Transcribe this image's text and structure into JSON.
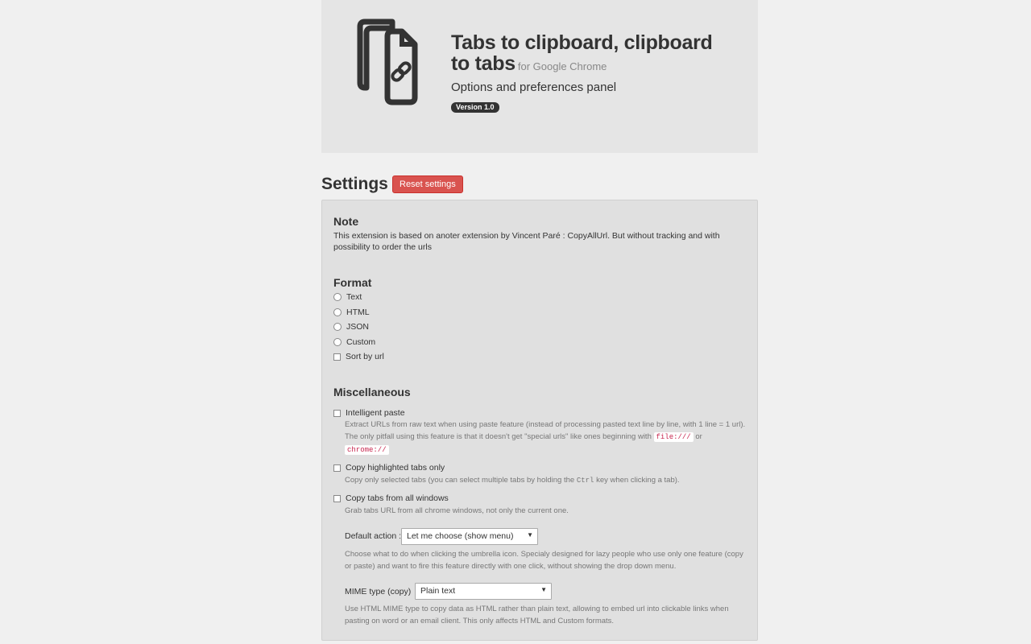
{
  "header": {
    "title": "Tabs to clipboard, clipboard to tabs",
    "title_suffix": "for Google Chrome",
    "subtitle": "Options and preferences panel",
    "version": "Version 1.0",
    "logo_icon": "documents-link-icon"
  },
  "settings": {
    "title": "Settings",
    "reset_label": "Reset settings",
    "reset_color": "#d9534f"
  },
  "note": {
    "title": "Note",
    "text": "This extension is based on anoter extension by Vincent Paré : CopyAllUrl. But without tracking and with possibility to order the urls"
  },
  "format": {
    "title": "Format",
    "options": [
      "Text",
      "HTML",
      "JSON",
      "Custom"
    ],
    "sort_label": "Sort by url"
  },
  "misc": {
    "title": "Miscellaneous",
    "intelligent_paste": {
      "label": "Intelligent paste",
      "desc1": "Extract URLs from raw text when using paste feature (instead of processing pasted text line by line, with 1 line = 1 url).",
      "desc2": "The only pitfall using this feature is that it doesn't get \"special urls\" like ones beginning with",
      "code1": "file:///",
      "or": "or",
      "code2": "chrome://"
    },
    "highlighted": {
      "label": "Copy highlighted tabs only",
      "desc_a": "Copy only selected tabs (you can select multiple tabs by holding the",
      "ctrl": "Ctrl",
      "desc_b": "key when clicking a tab)."
    },
    "all_windows": {
      "label": "Copy tabs from all windows",
      "desc": "Grab tabs URL from all chrome windows, not only the current one."
    },
    "default_action": {
      "label": "Default action :",
      "value": "Let me choose (show menu)",
      "desc": "Choose what to do when clicking the umbrella icon. Specialy designed for lazy people who use only one feature (copy or paste) and want to fire this feature directly with one click, without showing the drop down menu."
    },
    "mime": {
      "label": "MIME type (copy)",
      "value": "Plain text",
      "desc": "Use HTML MIME type to copy data as HTML rather than plain text, allowing to embed url into clickable links when pasting on word or an email client. This only affects HTML and Custom formats."
    }
  }
}
